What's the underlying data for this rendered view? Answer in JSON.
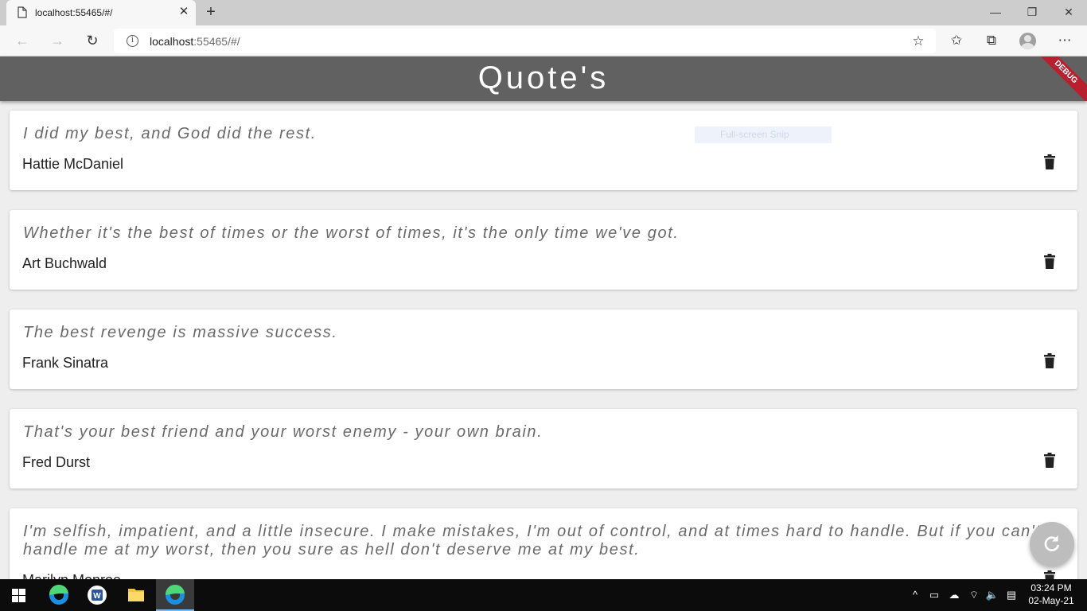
{
  "browser": {
    "tab_title": "localhost:55465/#/",
    "url_host": "localhost",
    "url_rest": ":55465/#/"
  },
  "app": {
    "title": "Quote's",
    "debug_banner": "DEBUG",
    "snip_overlay": "Full-screen Snip"
  },
  "quotes": [
    {
      "text": "I did my best, and God did the rest.",
      "author": "Hattie McDaniel"
    },
    {
      "text": "Whether it's the best of times or the worst of times, it's the only time we've got.",
      "author": "Art Buchwald"
    },
    {
      "text": "The best revenge is massive success.",
      "author": "Frank Sinatra"
    },
    {
      "text": "That's your best friend and your worst enemy - your own brain.",
      "author": "Fred Durst"
    },
    {
      "text": "I'm selfish, impatient, and a little insecure. I make mistakes, I'm out of control, and at times hard to handle. But if you can't handle me at my worst, then you sure as hell don't deserve me at my best.",
      "author": "Marilyn Monroe"
    }
  ],
  "taskbar": {
    "time": "03:24 PM",
    "date": "02-May-21"
  },
  "colors": {
    "appbar": "#616161",
    "debug": "#b8202f",
    "fab": "#bdbdbd"
  }
}
